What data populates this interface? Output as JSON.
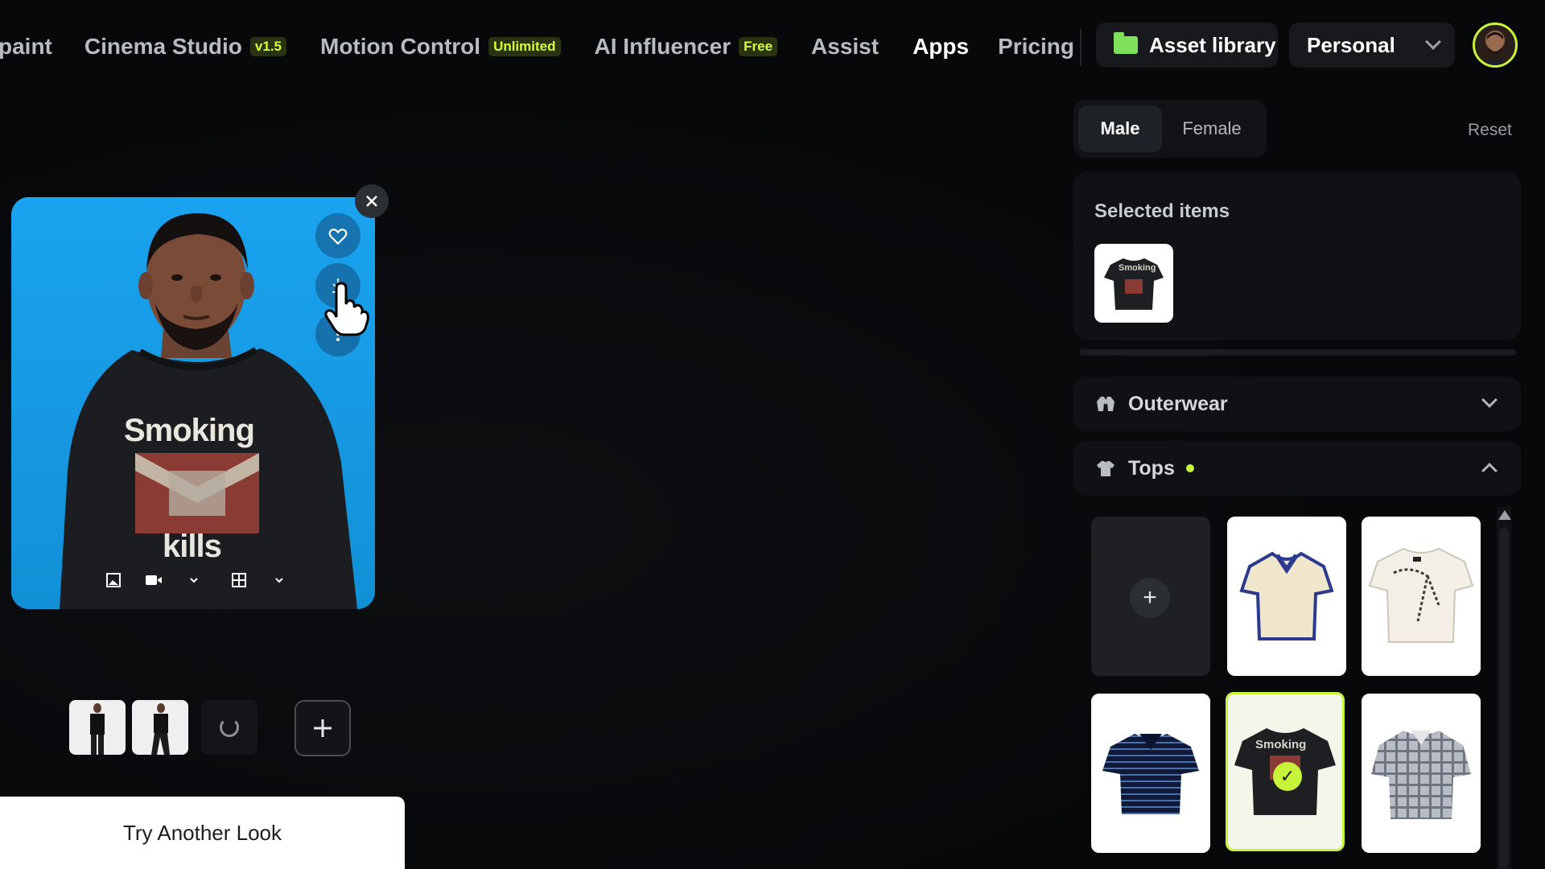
{
  "nav": {
    "links": [
      {
        "label": "paint",
        "badge": ""
      },
      {
        "label": "Cinema Studio",
        "badge": "v1.5"
      },
      {
        "label": "Motion Control",
        "badge": "Unlimited"
      },
      {
        "label": "AI Influencer",
        "badge": "Free"
      },
      {
        "label": "Assist",
        "badge": ""
      },
      {
        "label": "Apps",
        "badge": ""
      },
      {
        "label": "Pricing",
        "badge": ""
      }
    ],
    "active": "Apps",
    "asset_library": "Asset library",
    "workspace": "Personal"
  },
  "preview": {
    "shirt_line1": "Smoking",
    "shirt_line2": "kills",
    "actions": [
      "heart-icon",
      "download-icon",
      "more-icon"
    ],
    "tools": [
      "image-icon",
      "video-icon",
      "chevron-down-icon",
      "grid-icon",
      "chevron-down-icon"
    ]
  },
  "try_another": "Try Another Look",
  "panel": {
    "genders": [
      "Male",
      "Female"
    ],
    "selected_gender": "Male",
    "reset": "Reset",
    "selected_title": "Selected items",
    "sections": [
      {
        "label": "Outerwear",
        "icon": "jacket-icon",
        "expanded": false,
        "has_dot": false
      },
      {
        "label": "Tops",
        "icon": "tshirt-icon",
        "expanded": true,
        "has_dot": true
      }
    ],
    "selected_top": "Smoking"
  },
  "colors": {
    "accent": "#c7f33a",
    "card_bg": "#1a9ee8",
    "panel_bg": "#0f1114"
  }
}
